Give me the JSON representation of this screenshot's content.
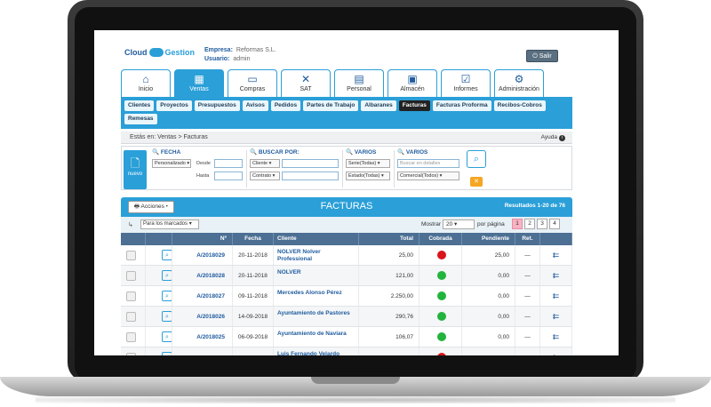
{
  "header": {
    "logo_text": "Cloud",
    "logo_text2": "Gestion",
    "empresa_label": "Empresa:",
    "empresa_value": "Reformas S.L.",
    "usuario_label": "Usuario:",
    "usuario_value": "admin",
    "salir_label": "Salir"
  },
  "tabs": [
    {
      "label": "Inicio",
      "icon": "home-icon",
      "glyph": "⌂"
    },
    {
      "label": "Ventas",
      "icon": "ventas-icon",
      "glyph": "▦"
    },
    {
      "label": "Compras",
      "icon": "compras-icon",
      "glyph": "▭"
    },
    {
      "label": "SAT",
      "icon": "tools-icon",
      "glyph": "✕"
    },
    {
      "label": "Personal",
      "icon": "id-card-icon",
      "glyph": "▤"
    },
    {
      "label": "Almacén",
      "icon": "boxes-icon",
      "glyph": "▣"
    },
    {
      "label": "Informes",
      "icon": "clipboard-icon",
      "glyph": "☑"
    },
    {
      "label": "Administración",
      "icon": "gears-icon",
      "glyph": "⚙"
    }
  ],
  "subtabs": [
    "Clientes",
    "Proyectos",
    "Presupuestos",
    "Avisos",
    "Pedidos",
    "Partes de Trabajo",
    "Albaranes",
    "Facturas",
    "Facturas Proforma",
    "Recibos-Cobros",
    "Remesas"
  ],
  "active_subtab": "Facturas",
  "breadcrumb": "Estás en: Ventas > Facturas",
  "ayuda": "Ayuda",
  "filters": {
    "nuevo_label": "nuevo",
    "fecha_head": "FECHA",
    "fecha_select": "Personalizado",
    "desde_label": "Desde",
    "hasta_label": "Hasta",
    "buscar_head": "BUSCAR POR:",
    "buscar_select1": "Cliente",
    "buscar_select2": "Contrato",
    "varios1_head": "VARIOS",
    "serie_select": "Serie(Todas)",
    "estado_select": "Estado(Todas)",
    "varios2_head": "VARIOS",
    "detalles_placeholder": "Buscar en detalles",
    "comercial_select": "Comercial(Todos)"
  },
  "results": {
    "acciones_label": "Acciones",
    "title": "FACTURAS",
    "resultados": "Resultados 1-20 de 76",
    "marcados_select": "Para los marcados",
    "mostrar_label": "Mostrar",
    "mostrar_value": "20",
    "porpag_label": "por página",
    "pages": [
      "1",
      "2",
      "3",
      "4"
    ]
  },
  "columns": [
    "",
    "",
    "Nº",
    "Fecha",
    "Cliente",
    "Total",
    "Cobrada",
    "Pendiente",
    "Ret.",
    ""
  ],
  "colors": {
    "accent": "#2a9fd8",
    "cobrada_no": "#d9141b",
    "cobrada_si": "#22b43c"
  },
  "rows": [
    {
      "num": "A/2018029",
      "fecha": "20-11-2018",
      "cliente": "NOLVER Nolver Professional",
      "total": "25,00",
      "cobrada": false,
      "pendiente": "25,00",
      "ret": "—"
    },
    {
      "num": "A/2018028",
      "fecha": "20-11-2018",
      "cliente": "NOLVER",
      "total": "121,00",
      "cobrada": true,
      "pendiente": "0,00",
      "ret": "—"
    },
    {
      "num": "A/2018027",
      "fecha": "09-11-2018",
      "cliente": "Mercedes Alonso Pérez",
      "total": "2.250,00",
      "cobrada": true,
      "pendiente": "0,00",
      "ret": "—"
    },
    {
      "num": "A/2018026",
      "fecha": "14-09-2018",
      "cliente": "Ayuntamiento de Pastores",
      "total": "290,76",
      "cobrada": true,
      "pendiente": "0,00",
      "ret": "—"
    },
    {
      "num": "A/2018025",
      "fecha": "06-09-2018",
      "cliente": "Ayuntamiento de Naviara",
      "total": "106,07",
      "cobrada": true,
      "pendiente": "0,00",
      "ret": "—"
    },
    {
      "num": "",
      "fecha": "",
      "cliente": "Luis Fernando Velardo",
      "total": "",
      "cobrada": false,
      "pendiente": "",
      "ret": ""
    }
  ]
}
